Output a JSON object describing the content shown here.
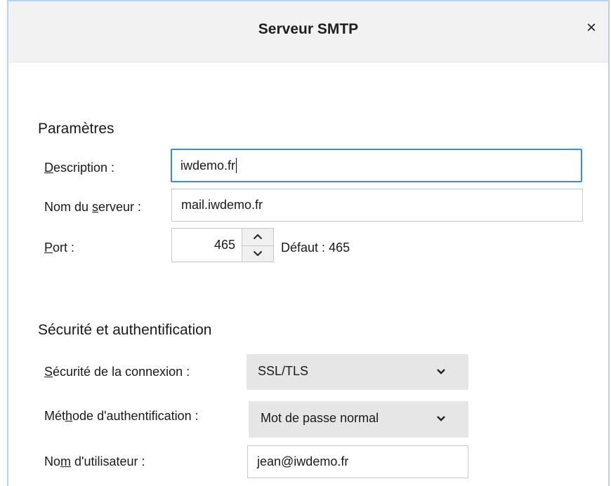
{
  "dialog": {
    "title": "Serveur SMTP",
    "close_glyph": "×"
  },
  "params": {
    "heading": "Paramètres",
    "description": {
      "label_prefix": "",
      "label_mnemonic": "D",
      "label_rest": "escription :",
      "value": "iwdemo.fr"
    },
    "server": {
      "label_prefix": "Nom du ",
      "label_mnemonic": "s",
      "label_rest": "erveur :",
      "value": "mail.iwdemo.fr"
    },
    "port": {
      "label_prefix": "",
      "label_mnemonic": "P",
      "label_rest": "ort :",
      "value": "465",
      "default_label": "Défaut :",
      "default_value": "465"
    }
  },
  "security": {
    "heading": "Sécurité et authentification",
    "connection": {
      "label_prefix": "",
      "label_mnemonic": "S",
      "label_rest": "écurité de la connexion :",
      "value": "SSL/TLS"
    },
    "auth_method": {
      "label_prefix": "Mét",
      "label_mnemonic": "h",
      "label_rest": "ode d'authentification :",
      "value": "Mot de passe normal"
    },
    "username": {
      "label_prefix": "No",
      "label_mnemonic": "m",
      "label_rest": " d'utilisateur :",
      "value": "jean@iwdemo.fr"
    }
  },
  "icons": {
    "close": "close-icon",
    "spin_up": "chevron-up-icon",
    "spin_down": "chevron-down-icon",
    "select": "chevron-down-icon"
  },
  "colors": {
    "focus_border": "#3c8ae3",
    "dialog_border": "#b9d3ee",
    "titlebar_bg": "#f2f2f2",
    "select_bg": "#e6e6e6"
  }
}
